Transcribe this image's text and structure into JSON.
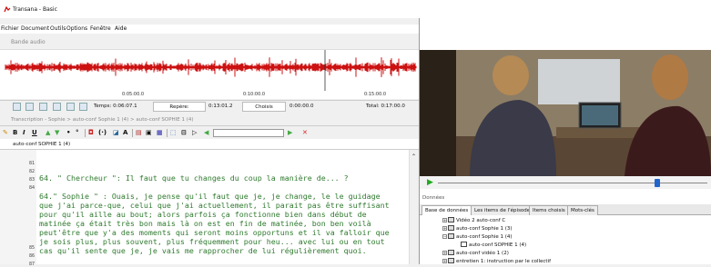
{
  "window": {
    "title": "Transana - Basic"
  },
  "menu": [
    "Fichier",
    "Document",
    "Outils",
    "Options",
    "Fenêtre",
    "Aide"
  ],
  "audio": {
    "header": "Bande audio",
    "ticks": [
      "0:05:00.0",
      "0:10:00.0",
      "0:15:00.0"
    ]
  },
  "toolbar": {
    "temps_label": "Temps: 0:06:07.1",
    "repere_label": "Repère:",
    "repere_value": "0:13:01.2",
    "choisis_label": "Choisis",
    "choisis_value": "0:00:00.0",
    "total_label": "Total: 0:17:00.0"
  },
  "breadcrumb": "Transcription - Sophie > auto-conf Sophie 1 (4) > auto-conf SOPHIE 1 (4)",
  "document_tab": "auto-conf SOPHIE 1 (4)",
  "editor": {
    "line_numbers": [
      "81",
      "82",
      "83",
      "84",
      "85",
      "86",
      "87"
    ],
    "lines": [
      "64. \" Chercheur \": Il faut que tu changes du coup la manière de... ?",
      "64.\" Sophie \" : Ouais, je pense qu'il faut que je, je change, le le guidage",
      "que j'ai parce-que, celui que j'ai actuellement, il parait pas être suffisant",
      "pour qu'il aille au bout; alors parfois ça fonctionne bien dans début de",
      "matinée ça était très bon mais là on est en fin de matinée, bon ben voilà",
      "peut'être que y'a des moments qui seront moins opportuns et il va falloir que",
      "je sois plus, plus souvent, plus fréquemment pour heu... avec lui ou en tout",
      "cas qu'il sente que je, je vais me rapprocher de lui régulièrement quoi."
    ]
  },
  "donnees": {
    "label": "Données",
    "tabs": [
      "Base de données",
      "Les items de l'épisode",
      "Items choisis",
      "Mots-clés"
    ],
    "tree": [
      "Vidéo 2 auto-conf C",
      "auto-conf Sophie 1 (3)",
      "auto-conf Sophie 1 (4)",
      "auto-conf SOPHIE 1 (4)",
      "auto-conf vidéo 1 (2)",
      "entretien 1: instruction par le collectif"
    ]
  },
  "colors": {
    "waveform": "#cc1111",
    "text": "#2f7a2f",
    "accent": "#2266cc"
  }
}
